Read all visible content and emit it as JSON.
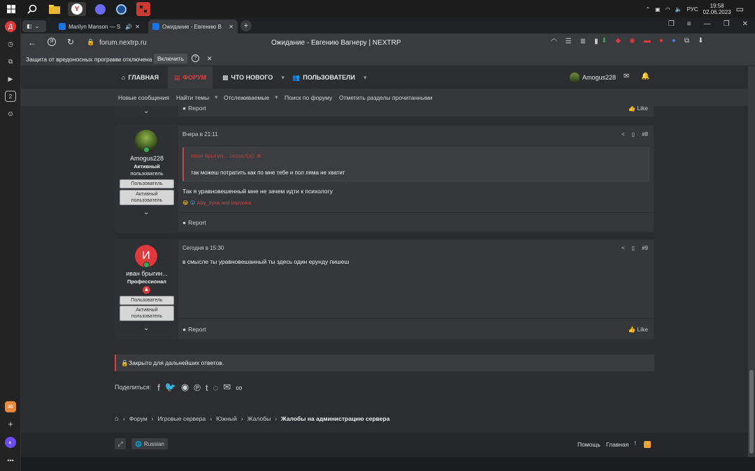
{
  "taskbar": {
    "clock_time": "19:58",
    "clock_date": "02.06.2023",
    "lang": "РУС"
  },
  "sidebar": {
    "profile_letter": "Д",
    "badge_count": "2"
  },
  "tabs": [
    {
      "title": "Marilyn Manson — S"
    },
    {
      "title": "Ожидание - Евгению В"
    }
  ],
  "address": {
    "url": "forum.nextrp.ru",
    "page_title": "Ожидание - Евгению Вагнеру | NEXTRP"
  },
  "protection": {
    "text": "Защита от вредоносных программ отключена",
    "enable_label": "Включить"
  },
  "nav": {
    "home": "ГЛАВНАЯ",
    "forum": "ФОРУМ",
    "whats_new": "ЧТО НОВОГО",
    "users": "ПОЛЬЗОВАТЕЛИ",
    "username": "Amogus228"
  },
  "subnav": {
    "items": [
      "Новые сообщения",
      "Найти темы",
      "Отслеживаемые",
      "Поиск по форуму",
      "Отметить разделы прочитанными"
    ]
  },
  "prev_post": {
    "report": "Report",
    "like": "Like"
  },
  "post8": {
    "author": "Amogus228",
    "title_line1": "Активный",
    "title_line2": "пользователь",
    "badge1": "Пользователь",
    "badge2_line1": "Активный",
    "badge2_line2": "пользователь",
    "time": "Вчера в 21:11",
    "number": "#8",
    "quote_author": "иван брыгин... сказал(а):",
    "quote_text": "так можеш потратить как по мне тебе и пол ляма не хватит",
    "text": "Так я уравновешенный мне не зачем идти к психологу",
    "reactions": "Aby_Ilyxa and bazooka",
    "report": "Report"
  },
  "post9": {
    "avatar_letter": "И",
    "author": "иван брыгин...",
    "title": "Профессионал",
    "badge1": "Пользователь",
    "badge2_line1": "Активный",
    "badge2_line2": "пользователь",
    "time": "Сегодня в 15:30",
    "number": "#9",
    "text": "в смысле ты уравновешанный ты здесь один ерунду пишеш",
    "report": "Report",
    "like": "Like"
  },
  "closed": {
    "text": "Закрыто для дальнейших ответов."
  },
  "share": {
    "label": "Поделиться:"
  },
  "breadcrumb": {
    "items": [
      "Форум",
      "Игровые сервера",
      "Южный",
      "Жалобы"
    ],
    "current": "Жалобы на администрацию сервера"
  },
  "footer": {
    "lang": "Russian",
    "help": "Помощь",
    "home": "Главная"
  },
  "colors": {
    "accent": "#d9413f",
    "avatar9": "#e0393b",
    "online": "#3aa657"
  }
}
